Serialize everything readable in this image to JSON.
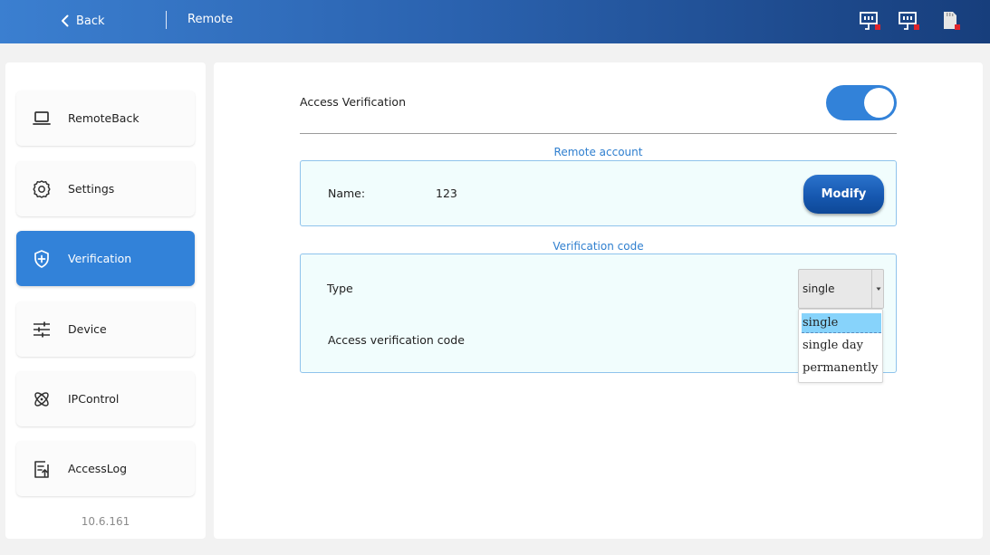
{
  "header": {
    "back_label": "Back",
    "title": "Remote",
    "status_icons": [
      "network-port-disconnected-icon",
      "network-port-disconnected-icon",
      "sd-card-missing-icon"
    ]
  },
  "sidebar": {
    "items": [
      {
        "label": "RemoteBack",
        "icon": "laptop-icon",
        "active": false
      },
      {
        "label": "Settings",
        "icon": "gear-icon",
        "active": false
      },
      {
        "label": "Verification",
        "icon": "shield-plus-icon",
        "active": true
      },
      {
        "label": "Device",
        "icon": "sliders-icon",
        "active": false
      },
      {
        "label": "IPControl",
        "icon": "atom-icon",
        "active": false
      },
      {
        "label": "AccessLog",
        "icon": "log-upload-icon",
        "active": false
      }
    ],
    "version": "10.6.161"
  },
  "main": {
    "access_verification": {
      "label": "Access Verification",
      "enabled": true
    },
    "remote_account": {
      "title": "Remote account",
      "name_label": "Name:",
      "name_value": "123",
      "modify_label": "Modify"
    },
    "verification_code": {
      "title": "Verification code",
      "type_label": "Type",
      "type_value": "single",
      "type_options": [
        "single",
        "single day",
        "permanently"
      ],
      "code_label": "Access verification code"
    }
  },
  "colors": {
    "accent": "#3282d9",
    "header_dark": "#173e7c",
    "panel_bg": "#f1fdfd",
    "panel_border": "#8fc3ec",
    "status_error": "#e0242b"
  }
}
